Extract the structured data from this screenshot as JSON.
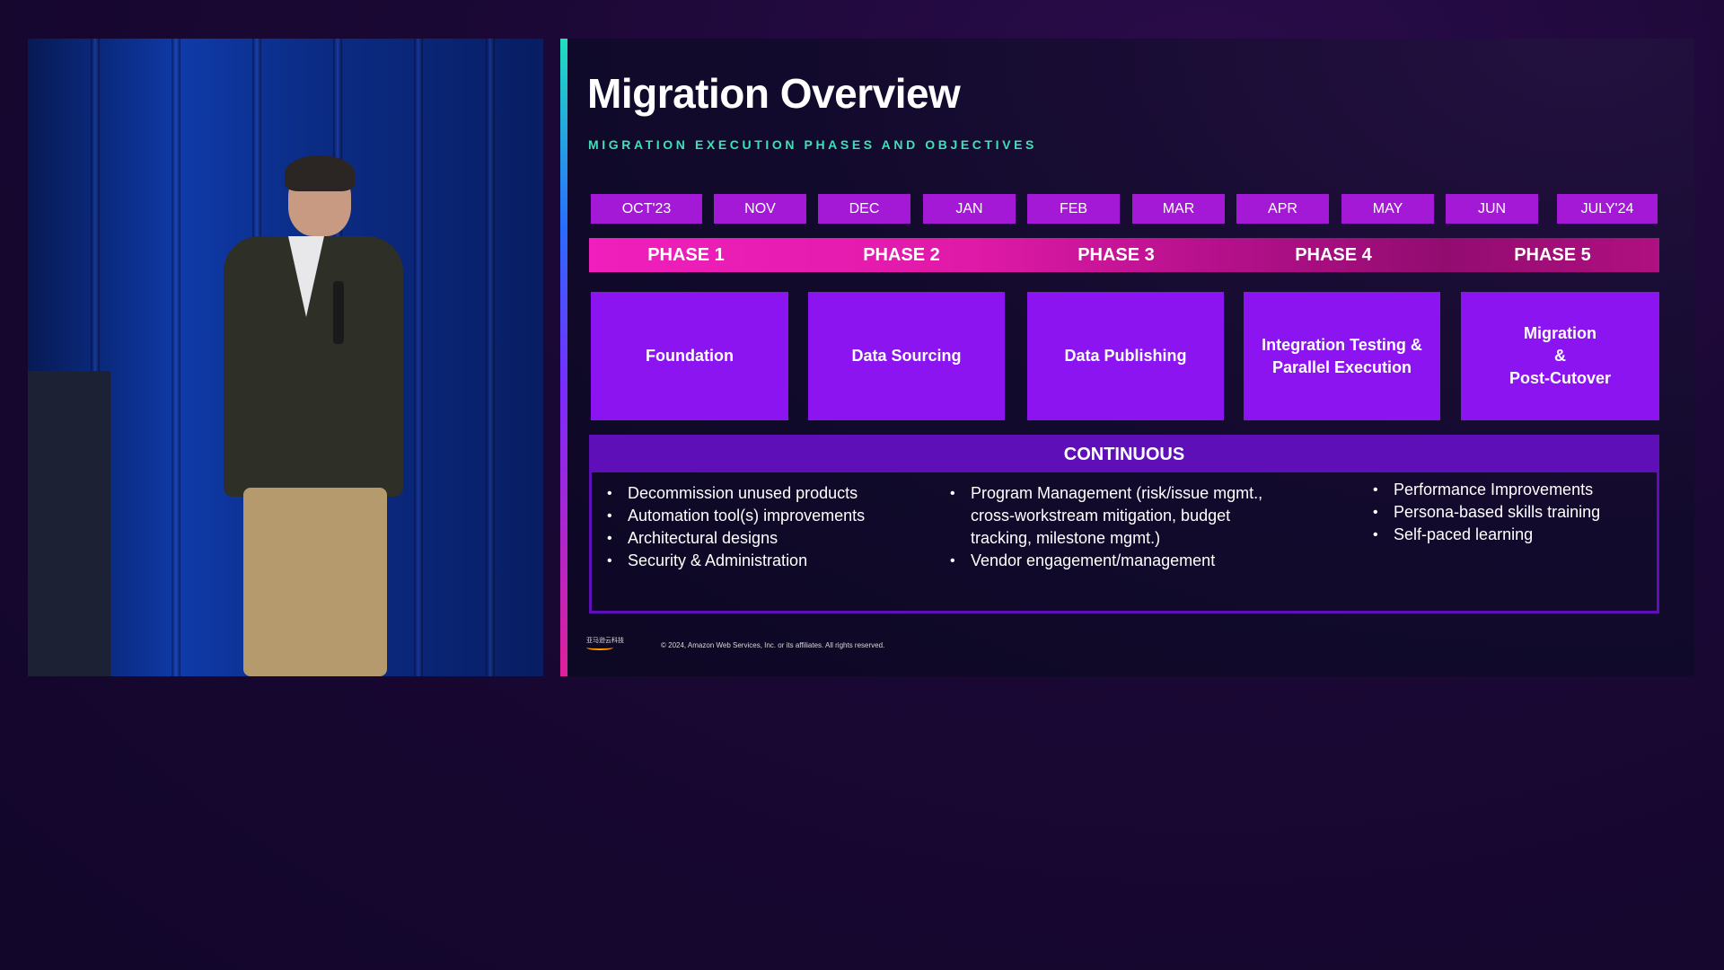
{
  "slide": {
    "title": "Migration Overview",
    "subtitle": "MIGRATION EXECUTION PHASES AND OBJECTIVES",
    "months": [
      "OCT'23",
      "NOV",
      "DEC",
      "JAN",
      "FEB",
      "MAR",
      "APR",
      "MAY",
      "JUN",
      "JULY'24"
    ],
    "phases": [
      "PHASE 1",
      "PHASE 2",
      "PHASE 3",
      "PHASE 4",
      "PHASE 5"
    ],
    "phase_boxes": [
      "Foundation",
      "Data Sourcing",
      "Data Publishing",
      "Integration Testing &\nParallel Execution",
      "Migration\n&\nPost-Cutover"
    ],
    "continuous": {
      "header": "CONTINUOUS",
      "col1": [
        "Decommission unused products",
        "Automation tool(s) improvements",
        "Architectural designs",
        "Security & Administration"
      ],
      "col2": [
        "Program Management (risk/issue mgmt., cross-workstream mitigation, budget tracking, milestone mgmt.)",
        "Vendor engagement/management"
      ],
      "col3": [
        "Performance Improvements",
        "Persona-based skills training",
        "Self-paced learning"
      ]
    },
    "footer": {
      "logo_text": "亚马逊云科技",
      "copyright": "© 2024, Amazon Web Services, Inc. or its affiliates. All rights reserved."
    }
  },
  "colors": {
    "month_tab": "#a319d6",
    "phase_bar": "#e01aa8",
    "phase_box": "#8b14f0",
    "continuous": "#5e0fb8",
    "subtitle": "#3fe0b8"
  }
}
